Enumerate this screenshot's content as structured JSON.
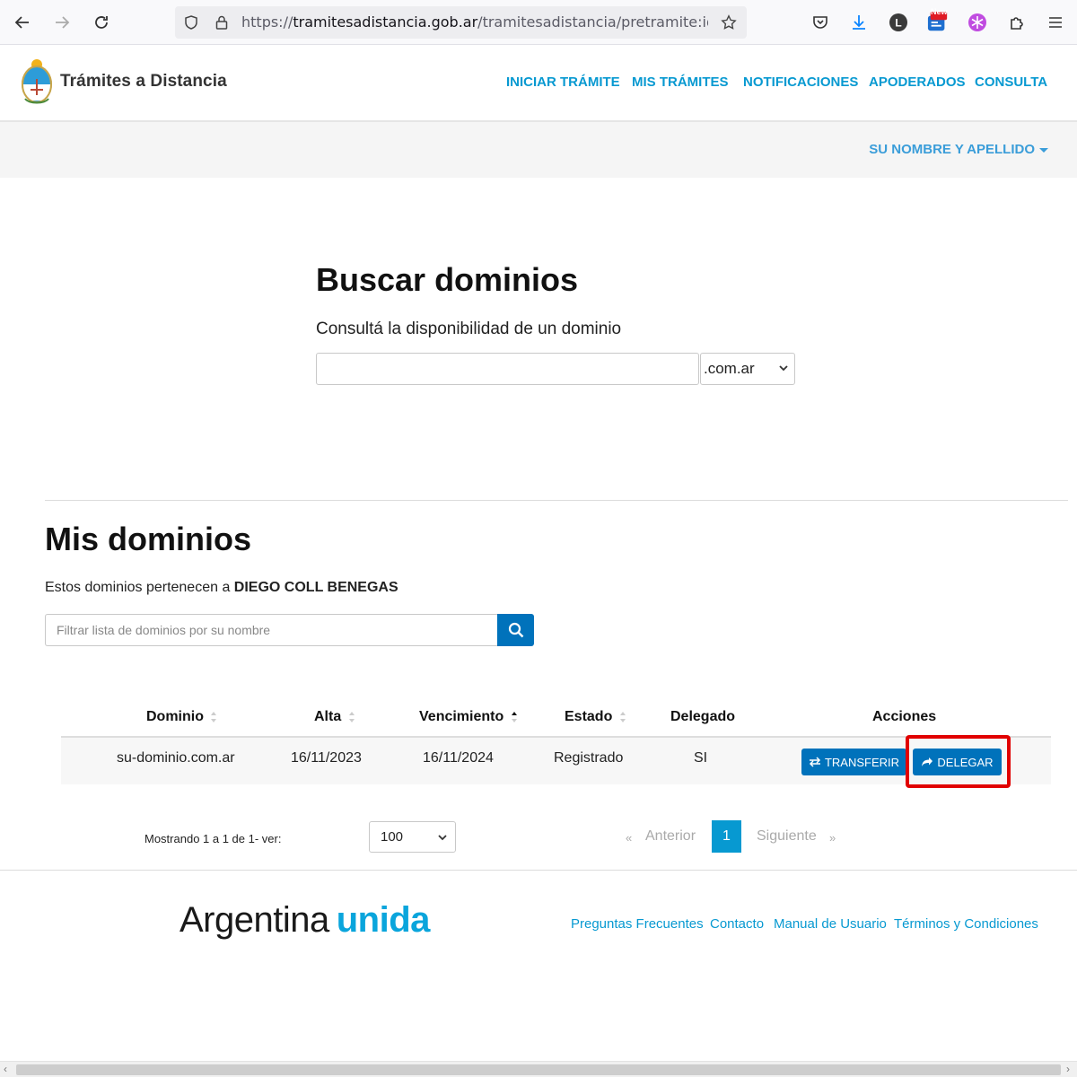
{
  "browser": {
    "url_prefix": "https://",
    "url_host": "tramitesadistancia.gob.ar",
    "url_path": "/tramitesadistancia/pretramite:idTipoTr",
    "badge_new": "New"
  },
  "header": {
    "site_title": "Trámites a Distancia",
    "nav": [
      "INICIAR TRÁMITE",
      "MIS TRÁMITES",
      "NOTIFICACIONES",
      "APODERADOS",
      "CONSULTA"
    ],
    "user_menu": "SU NOMBRE Y APELLIDO"
  },
  "search": {
    "title": "Buscar dominios",
    "subtitle": "Consultá la disponibilidad de un dominio",
    "input_value": "",
    "tld_selected": ".com.ar"
  },
  "mis": {
    "title": "Mis dominios",
    "owner_prefix": "Estos dominios pertenecen a",
    "owner_name": "DIEGO COLL BENEGAS",
    "filter_placeholder": "Filtrar lista de dominios por su nombre"
  },
  "table": {
    "headers": [
      "Dominio",
      "Alta",
      "Vencimiento",
      "Estado",
      "Delegado",
      "Acciones"
    ],
    "rows": [
      {
        "dominio": "su-dominio.com.ar",
        "alta": "16/11/2023",
        "vencimiento": "16/11/2024",
        "estado": "Registrado",
        "delegado": "SI",
        "actions": [
          "TRANSFERIR",
          "DELEGAR"
        ]
      }
    ]
  },
  "pagination": {
    "showing": "Mostrando 1 a 1 de 1- ver:",
    "per_page": "100",
    "prev": "Anterior",
    "current": "1",
    "next": "Siguiente",
    "prev_arrow": "«",
    "next_arrow": "»"
  },
  "footer": {
    "brand_a": "Argentina",
    "brand_b": "unida",
    "links": [
      "Preguntas Frecuentes",
      "Contacto",
      "Manual de Usuario",
      "Términos y Condiciones"
    ]
  },
  "colors": {
    "accent_blue": "#0799d1",
    "button_blue": "#0072bb",
    "highlight_red": "#e10000"
  }
}
